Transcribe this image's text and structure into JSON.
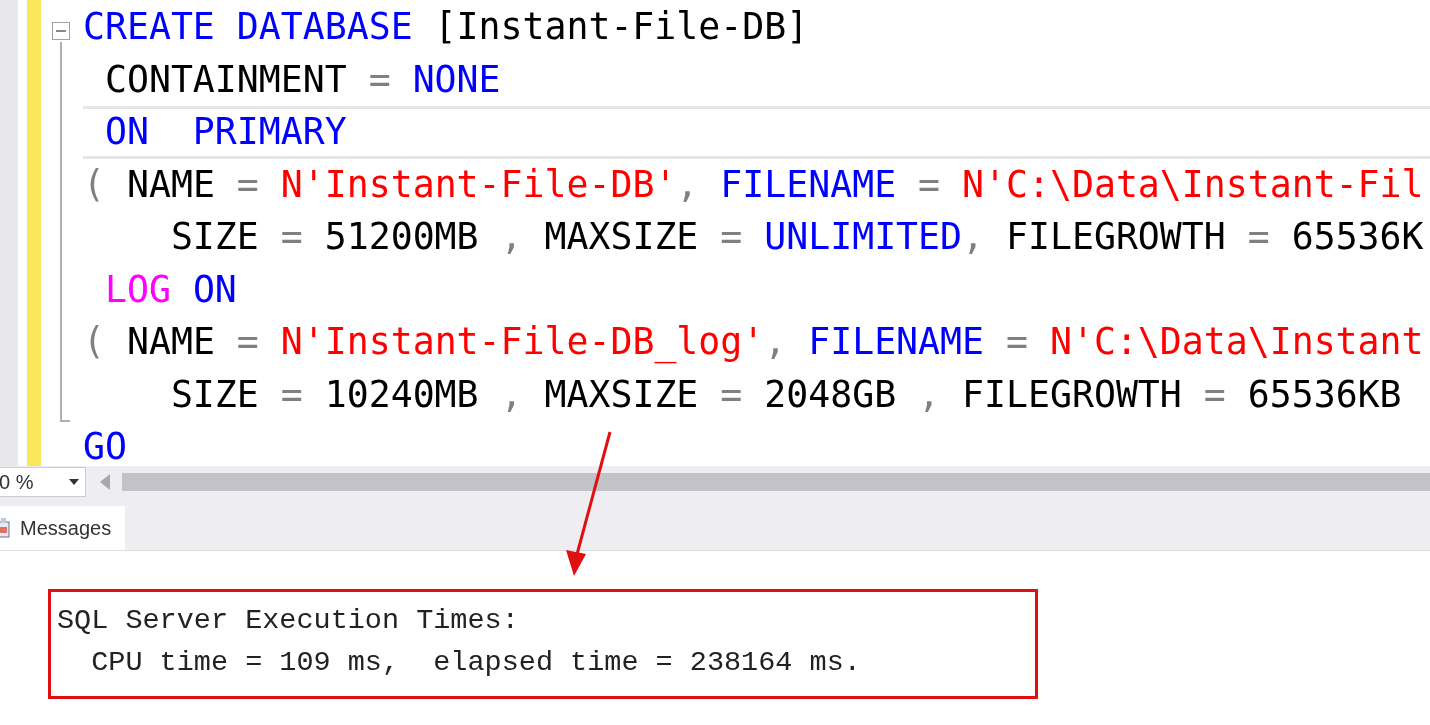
{
  "editor": {
    "lines": [
      {
        "current": false,
        "tokens": [
          {
            "kind": "keyword",
            "text": "CREATE DATABASE"
          },
          {
            "kind": "plain",
            "text": " [Instant-File-DB]"
          }
        ]
      },
      {
        "current": false,
        "tokens": [
          {
            "kind": "plain",
            "text": " CONTAINMENT "
          },
          {
            "kind": "operator",
            "text": "="
          },
          {
            "kind": "keyword",
            "text": " NONE"
          }
        ]
      },
      {
        "current": true,
        "tokens": [
          {
            "kind": "keyword",
            "text": " ON  PRIMARY"
          }
        ]
      },
      {
        "current": false,
        "tokens": [
          {
            "kind": "operator",
            "text": "("
          },
          {
            "kind": "plain",
            "text": " NAME "
          },
          {
            "kind": "operator",
            "text": "="
          },
          {
            "kind": "string",
            "text": " N'Instant-File-DB'"
          },
          {
            "kind": "operator",
            "text": ","
          },
          {
            "kind": "keyword",
            "text": " FILENAME"
          },
          {
            "kind": "operator",
            "text": " ="
          },
          {
            "kind": "string",
            "text": " N'C:\\Data\\Instant-Fil"
          }
        ]
      },
      {
        "current": false,
        "tokens": [
          {
            "kind": "plain",
            "text": "    SIZE "
          },
          {
            "kind": "operator",
            "text": "="
          },
          {
            "kind": "plain",
            "text": " 51200MB "
          },
          {
            "kind": "operator",
            "text": ","
          },
          {
            "kind": "plain",
            "text": " MAXSIZE "
          },
          {
            "kind": "operator",
            "text": "="
          },
          {
            "kind": "keyword",
            "text": " UNLIMITED"
          },
          {
            "kind": "operator",
            "text": ","
          },
          {
            "kind": "plain",
            "text": " FILEGROWTH "
          },
          {
            "kind": "operator",
            "text": "="
          },
          {
            "kind": "plain",
            "text": " 65536K"
          }
        ]
      },
      {
        "current": false,
        "tokens": [
          {
            "kind": "function",
            "text": " LOG"
          },
          {
            "kind": "keyword",
            "text": " ON"
          }
        ]
      },
      {
        "current": false,
        "tokens": [
          {
            "kind": "operator",
            "text": "("
          },
          {
            "kind": "plain",
            "text": " NAME "
          },
          {
            "kind": "operator",
            "text": "="
          },
          {
            "kind": "string",
            "text": " N'Instant-File-DB_log'"
          },
          {
            "kind": "operator",
            "text": ","
          },
          {
            "kind": "keyword",
            "text": " FILENAME"
          },
          {
            "kind": "operator",
            "text": " ="
          },
          {
            "kind": "string",
            "text": " N'C:\\Data\\Instant"
          }
        ]
      },
      {
        "current": false,
        "tokens": [
          {
            "kind": "plain",
            "text": "    SIZE "
          },
          {
            "kind": "operator",
            "text": "="
          },
          {
            "kind": "plain",
            "text": " 10240MB "
          },
          {
            "kind": "operator",
            "text": ","
          },
          {
            "kind": "plain",
            "text": " MAXSIZE "
          },
          {
            "kind": "operator",
            "text": "="
          },
          {
            "kind": "plain",
            "text": " 2048GB "
          },
          {
            "kind": "operator",
            "text": ","
          },
          {
            "kind": "plain",
            "text": " FILEGROWTH "
          },
          {
            "kind": "operator",
            "text": "="
          },
          {
            "kind": "plain",
            "text": " 65536KB"
          }
        ]
      },
      {
        "current": false,
        "tokens": [
          {
            "kind": "keyword",
            "text": "GO"
          }
        ]
      }
    ]
  },
  "zoom": {
    "value": "0 %"
  },
  "tabs": [
    {
      "label": "Messages",
      "selected": true
    }
  ],
  "messages": [
    "SQL Server Execution Times:",
    "  CPU time = 109 ms,  elapsed time = 238164 ms."
  ]
}
